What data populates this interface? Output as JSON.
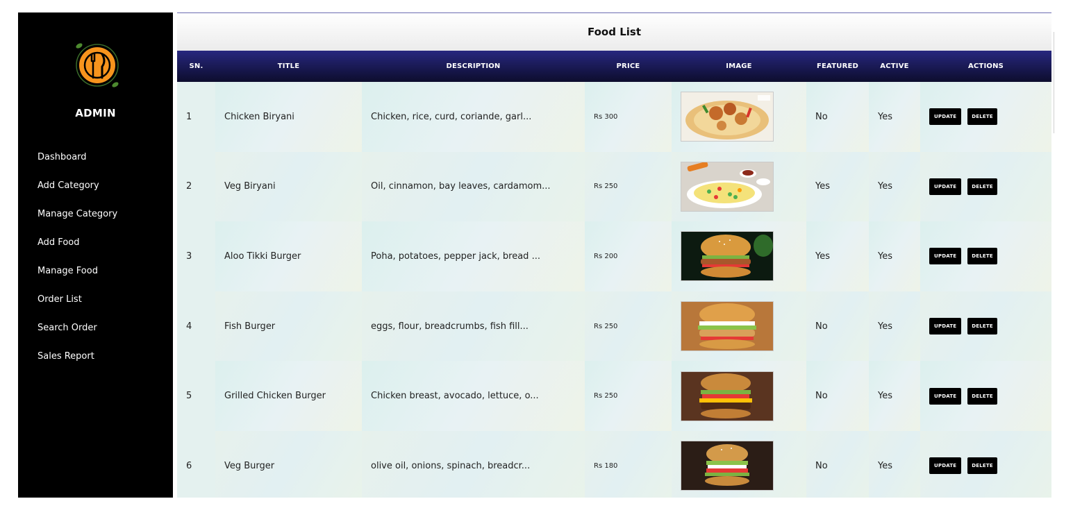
{
  "sidebar": {
    "title": "ADMIN",
    "logo_icon": "fork-knife-plate-logo",
    "items": [
      {
        "label": "Dashboard"
      },
      {
        "label": "Add Category"
      },
      {
        "label": "Manage Category"
      },
      {
        "label": "Add Food"
      },
      {
        "label": "Manage Food"
      },
      {
        "label": "Order List"
      },
      {
        "label": "Search Order"
      },
      {
        "label": "Sales Report"
      }
    ]
  },
  "main": {
    "title": "Food List",
    "columns": [
      "SN.",
      "TITLE",
      "DESCRIPTION",
      "PRICE",
      "IMAGE",
      "FEATURED",
      "ACTIVE",
      "ACTIONS"
    ],
    "actions": {
      "update_label": "UPDATE",
      "delete_label": "DELETE"
    },
    "rows": [
      {
        "sn": "1",
        "title": "Chicken Biryani",
        "description": "Chicken, rice, curd, coriande, garl...",
        "price": "Rs 300",
        "image": "chicken-biryani-photo",
        "featured": "No",
        "active": "Yes"
      },
      {
        "sn": "2",
        "title": "Veg Biryani",
        "description": "Oil, cinnamon, bay leaves, cardamom...",
        "price": "Rs 250",
        "image": "veg-biryani-photo",
        "featured": "Yes",
        "active": "Yes"
      },
      {
        "sn": "3",
        "title": "Aloo Tikki Burger",
        "description": "Poha, potatoes, pepper jack, bread ...",
        "price": "Rs 200",
        "image": "aloo-tikki-burger-photo",
        "featured": "Yes",
        "active": "Yes"
      },
      {
        "sn": "4",
        "title": "Fish Burger",
        "description": "eggs, flour, breadcrumbs, fish fill...",
        "price": "Rs 250",
        "image": "fish-burger-photo",
        "featured": "No",
        "active": "Yes"
      },
      {
        "sn": "5",
        "title": "Grilled Chicken Burger",
        "description": "Chicken breast, avocado, lettuce, o...",
        "price": "Rs 250",
        "image": "grilled-chicken-burger-photo",
        "featured": "No",
        "active": "Yes"
      },
      {
        "sn": "6",
        "title": "Veg Burger",
        "description": "olive oil, onions, spinach, breadcr...",
        "price": "Rs 180",
        "image": "veg-burger-photo",
        "featured": "No",
        "active": "Yes"
      }
    ]
  },
  "colors": {
    "sidebar_bg": "#000000",
    "header_bg": "#1c1c66",
    "logo_orange": "#f7941d",
    "button_bg": "#000000"
  }
}
